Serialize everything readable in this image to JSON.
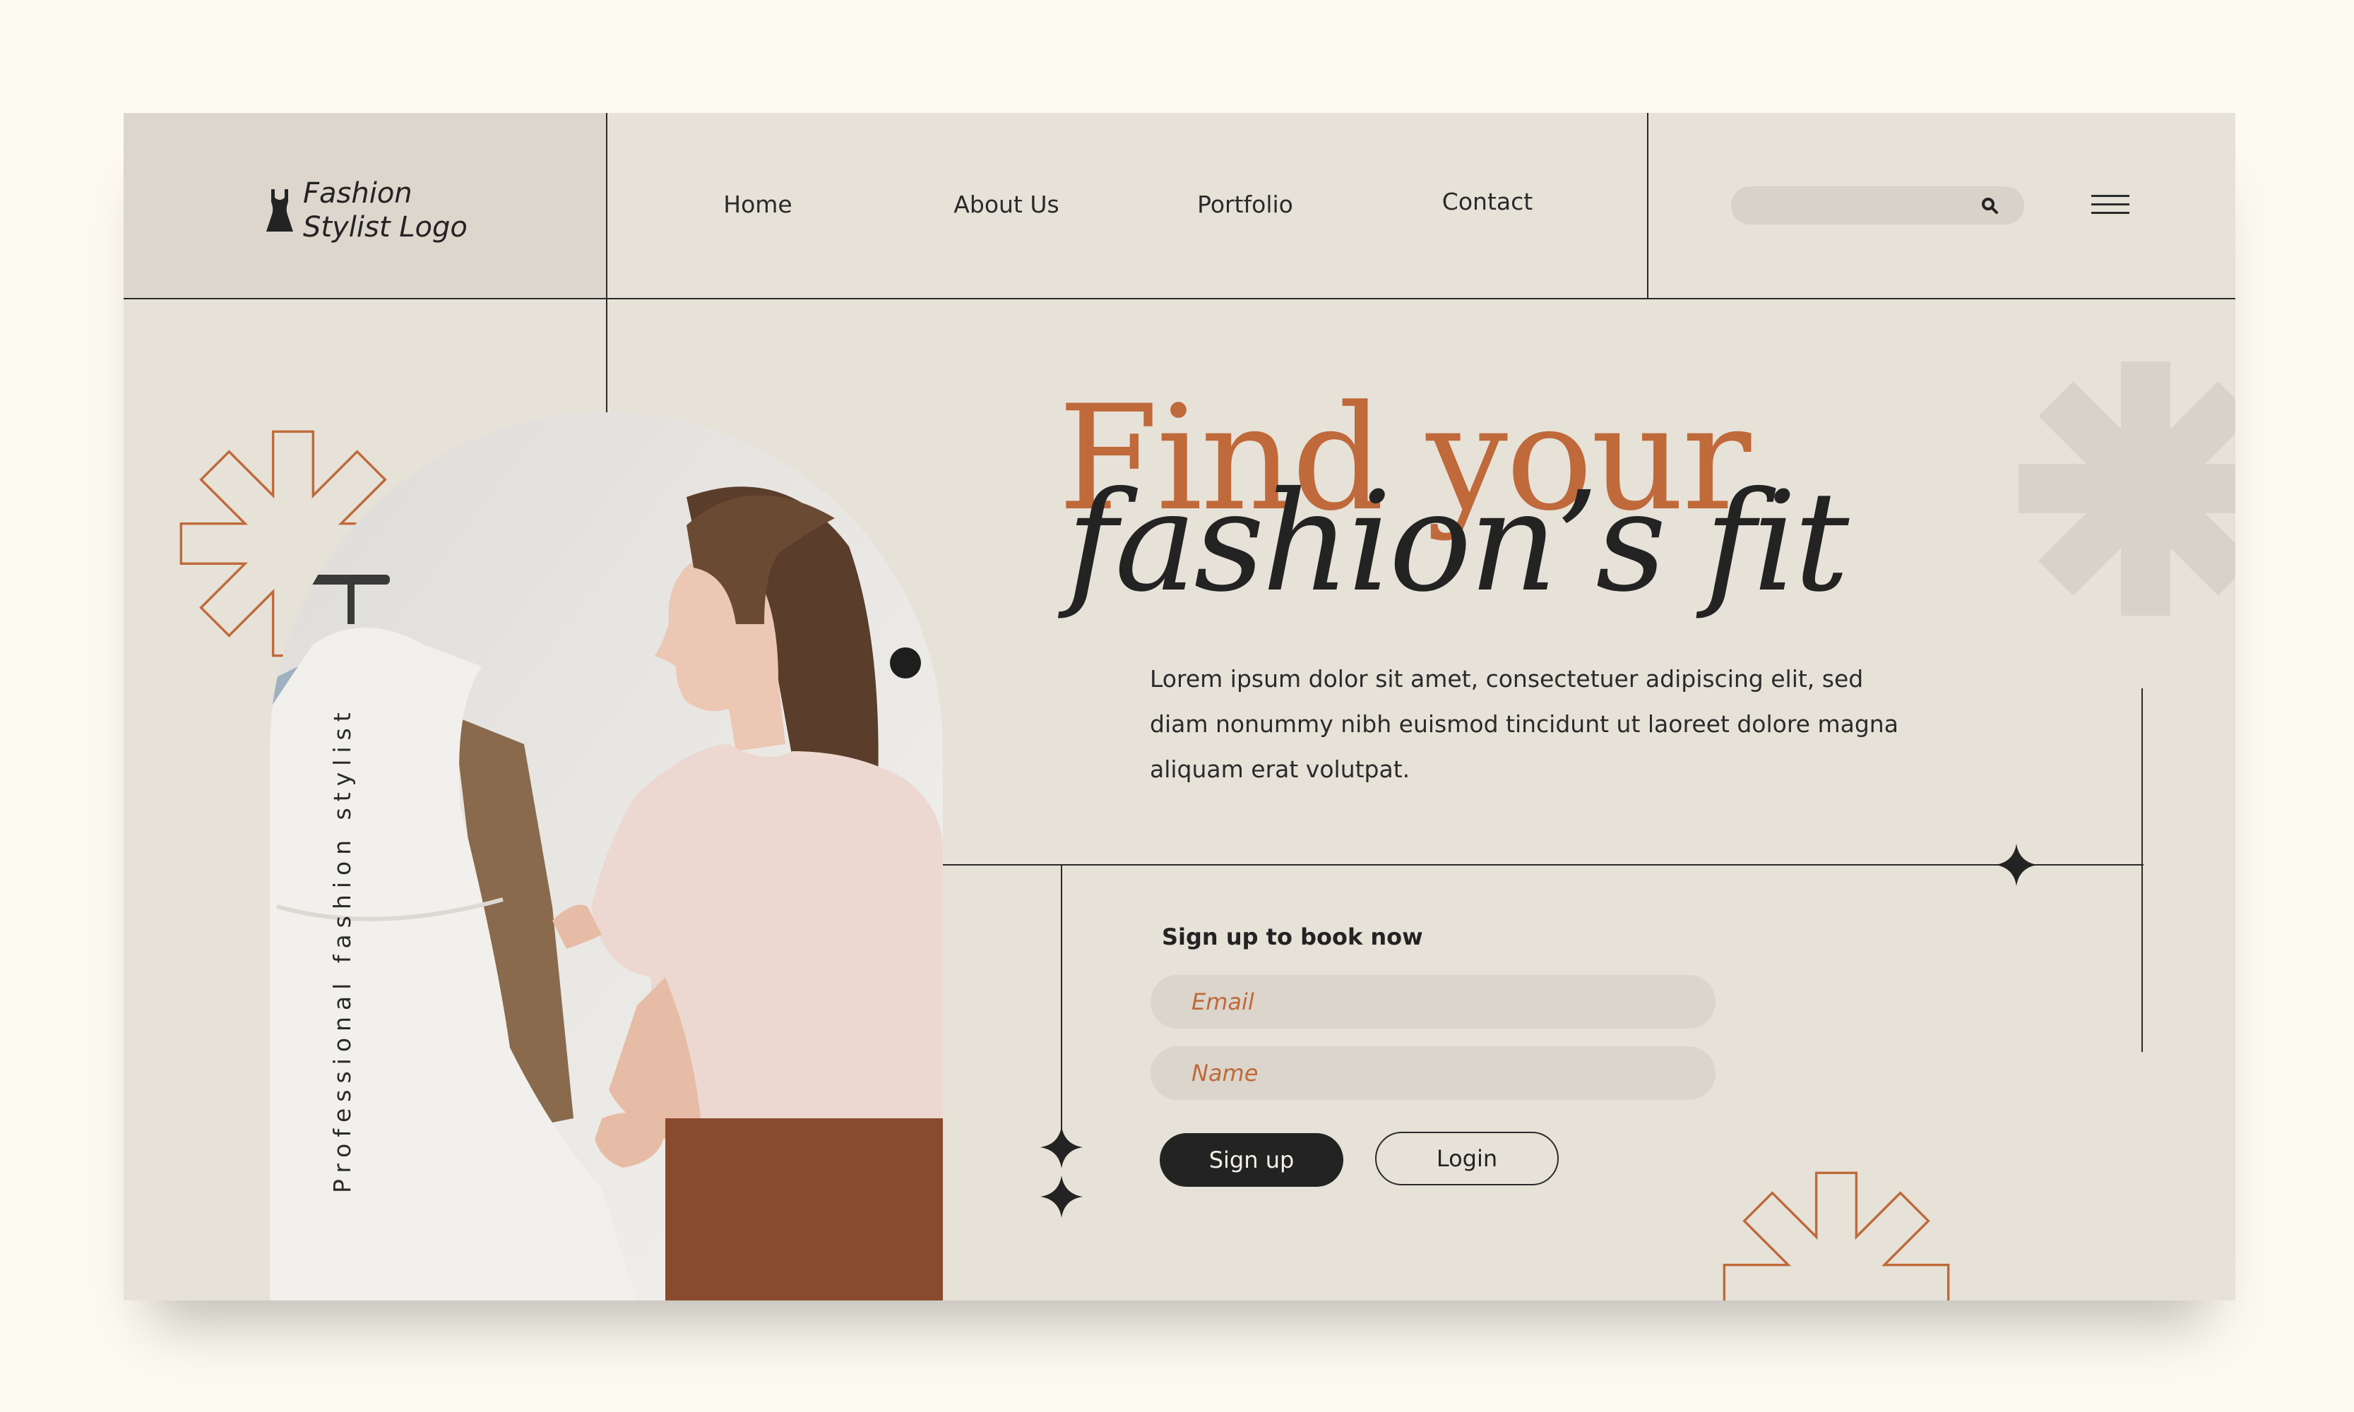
{
  "logo": {
    "line1": "Fashion",
    "line2": "Stylist Logo"
  },
  "nav": {
    "items": [
      "Home",
      "About Us",
      "Portfolio",
      "Contact"
    ]
  },
  "search": {
    "placeholder": ""
  },
  "side_text": "Professional fashion stylist",
  "hero": {
    "title_line1": "Find your",
    "title_line2": "fashion’s fit",
    "paragraph": "Lorem ipsum dolor sit amet, consectetuer adipiscing elit, sed diam nonummy nibh euismod tincidunt ut laoreet dolore magna aliquam erat volutpat."
  },
  "form": {
    "title": "Sign up to book now",
    "email_placeholder": "Email",
    "name_placeholder": "Name",
    "signup_label": "Sign up",
    "login_label": "Login"
  },
  "social": [
    "facebook-icon",
    "instagram-icon",
    "twitter-icon"
  ],
  "colors": {
    "background": "#fdfaf0",
    "card": "#e6e2d8",
    "logo_cell": "#dcd6cc",
    "accent": "#c0693a",
    "dark": "#232323"
  }
}
